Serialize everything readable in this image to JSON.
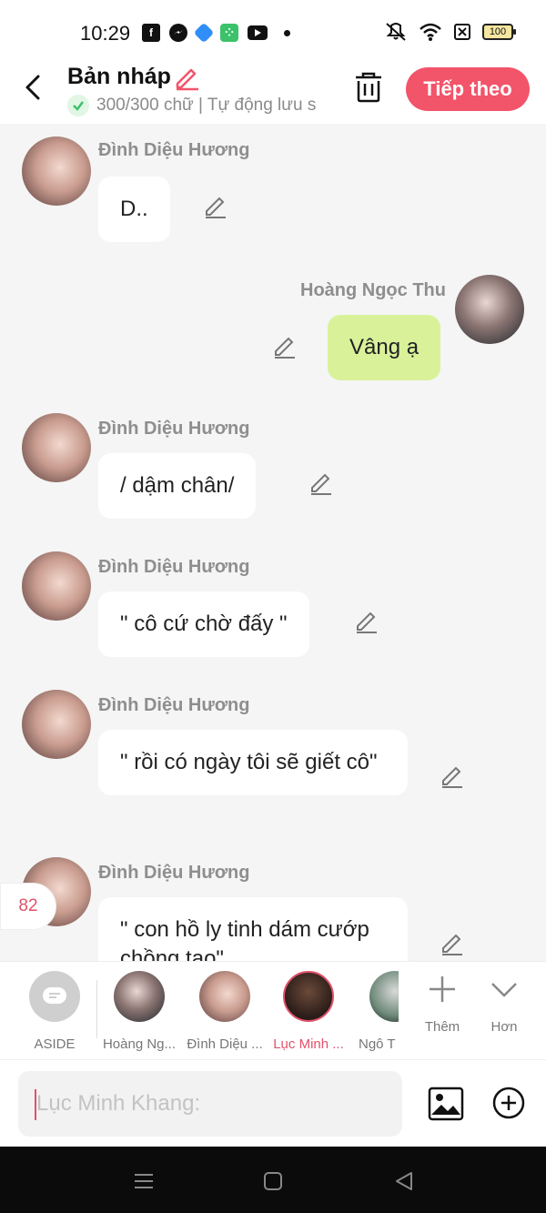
{
  "status": {
    "time": "10:29",
    "battery": "100",
    "colors": {
      "facebook": "#1877f2",
      "messenger": "#a33bff",
      "app_blue": "#2f8ef7",
      "app_green": "#3cc26a",
      "youtube": "#111111"
    }
  },
  "header": {
    "title": "Bản nháp",
    "subtitle": "300/300 chữ | Tự động lưu s",
    "next_label": "Tiếp theo",
    "accent": "#f2546a"
  },
  "messages": [
    {
      "sender": "Đình Diệu Hương",
      "text": "D..",
      "side": "left"
    },
    {
      "sender": "Hoàng Ngọc Thu",
      "text": "Vâng ạ",
      "side": "right"
    },
    {
      "sender": "Đình Diệu Hương",
      "text": "/ dậm chân/",
      "side": "left"
    },
    {
      "sender": "Đình Diệu Hương",
      "text": "\" cô cứ chờ đấy \"",
      "side": "left"
    },
    {
      "sender": "Đình Diệu Hương",
      "text": "\" rồi có ngày tôi sẽ giết cô\"",
      "side": "left"
    },
    {
      "sender": "Đình Diệu Hương",
      "text": "\" con hồ ly tinh dám cướp chồng tao\"",
      "side": "left"
    }
  ],
  "count_badge": "82",
  "characters": [
    {
      "name": "ASIDE"
    },
    {
      "name": "Hoàng Ng..."
    },
    {
      "name": "Đình Diệu ..."
    },
    {
      "name": "Lục Minh ..."
    },
    {
      "name": "Ngô T"
    }
  ],
  "tools": {
    "add_label": "Thêm",
    "more_label": "Hơn"
  },
  "input": {
    "placeholder": "Lục Minh Khang:"
  }
}
